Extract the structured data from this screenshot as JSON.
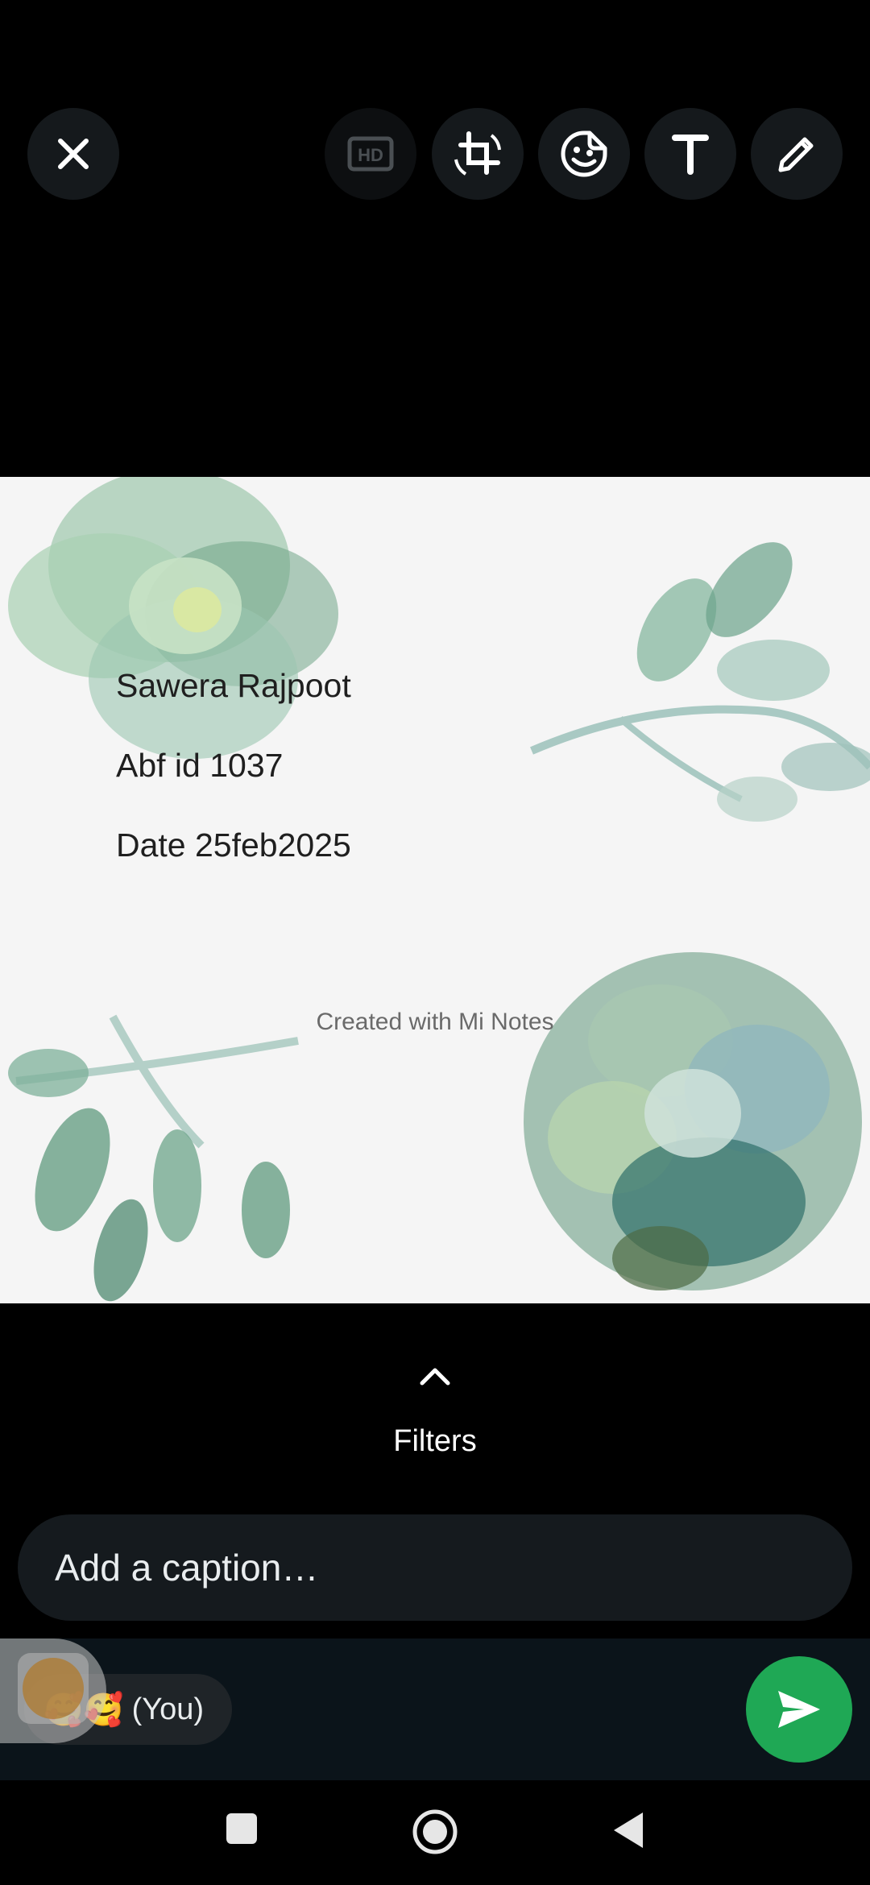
{
  "toolbar": {
    "close_icon": "close-icon",
    "hd_icon": "hd-icon",
    "crop_rotate_icon": "crop-rotate-icon",
    "sticker_icon": "sticker-icon",
    "text_icon": "text-icon",
    "draw_icon": "pencil-icon"
  },
  "note": {
    "lines": [
      "Sawera Rajpoot",
      "Abf id 1037",
      "Date 25feb2025"
    ],
    "watermark": "Created with Mi Notes"
  },
  "filters": {
    "label": "Filters",
    "icon": "chevron-up-icon"
  },
  "caption": {
    "placeholder": "Add a caption…"
  },
  "recipient": {
    "emoji": "🥰🥰",
    "label": "(You)"
  },
  "send": {
    "icon": "send-icon",
    "color": "#1fa855"
  },
  "navbar": {
    "items": [
      "recents-icon",
      "home-icon",
      "back-icon"
    ]
  }
}
